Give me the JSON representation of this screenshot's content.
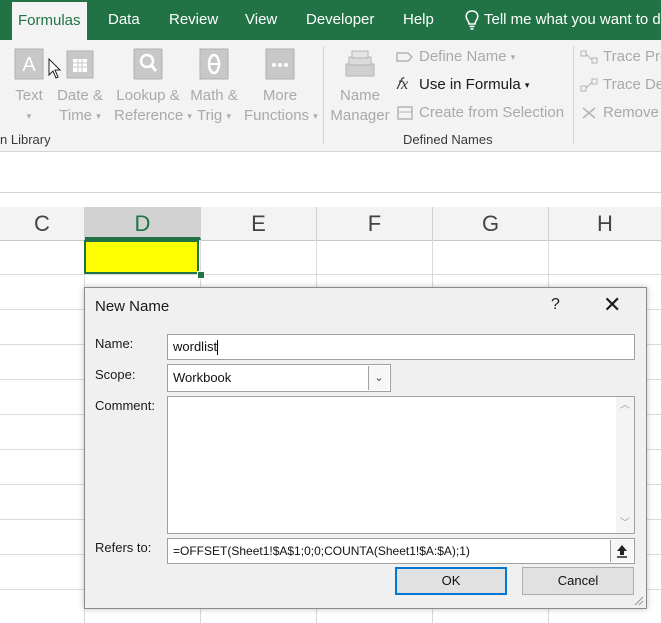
{
  "tabs": [
    {
      "label": "Formulas",
      "active": true
    },
    {
      "label": "Data"
    },
    {
      "label": "Review"
    },
    {
      "label": "View"
    },
    {
      "label": "Developer"
    },
    {
      "label": "Help"
    }
  ],
  "tell_me": "Tell me what you want to d",
  "ribbon": {
    "library": {
      "text_btn": "Text",
      "date_btn": [
        "Date &",
        "Time"
      ],
      "lookup_btn": [
        "Lookup &",
        "Reference"
      ],
      "math_btn": [
        "Math &",
        "Trig"
      ],
      "more_btn": [
        "More",
        "Functions"
      ],
      "group_label": "n Library"
    },
    "defined_names": {
      "name_manager": [
        "Name",
        "Manager"
      ],
      "define_name": "Define Name",
      "use_in_formula": "Use in Formula",
      "create_from_selection": "Create from Selection",
      "group_label": "Defined Names"
    },
    "auditing": {
      "trace_precedents": "Trace Pre",
      "trace_dependents": "Trace De",
      "remove_arrows": "Remove"
    }
  },
  "columns": [
    "C",
    "D",
    "E",
    "F",
    "G",
    "H"
  ],
  "selected_column": "D",
  "dialog": {
    "title": "New Name",
    "help": "?",
    "close": "✕",
    "name_label": "Name:",
    "name_value": "wordlist",
    "scope_label": "Scope:",
    "scope_value": "Workbook",
    "comment_label": "Comment:",
    "comment_value": "",
    "refers_label": "Refers to:",
    "refers_value": "=OFFSET(Sheet1!$A$1;0;0;COUNTA(Sheet1!$A:$A);1)",
    "ok": "OK",
    "cancel": "Cancel"
  },
  "colors": {
    "accent": "#217346",
    "highlight": "#ffff00",
    "focus": "#0078d7"
  }
}
